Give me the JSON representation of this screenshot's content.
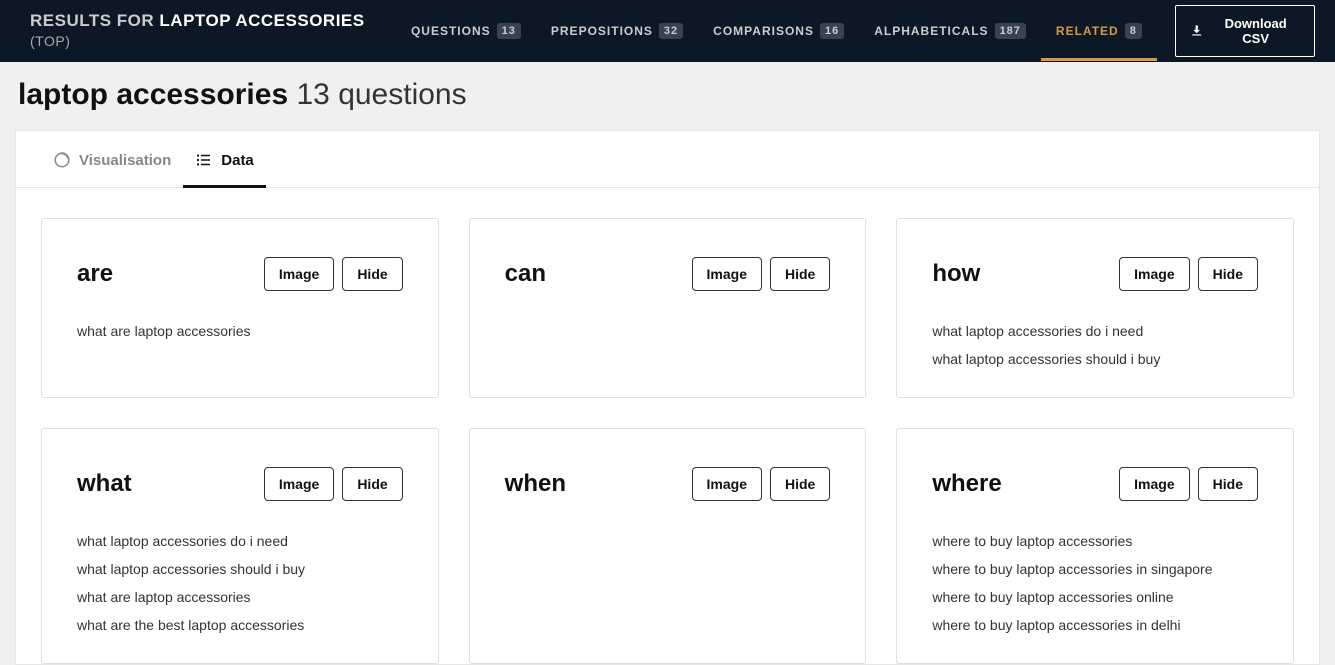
{
  "header": {
    "results_for_prefix": "RESULTS FOR",
    "keyword": "LAPTOP ACCESSORIES",
    "suffix": "(TOP)"
  },
  "nav": [
    {
      "label": "QUESTIONS",
      "count": "13",
      "active": false
    },
    {
      "label": "PREPOSITIONS",
      "count": "32",
      "active": false
    },
    {
      "label": "COMPARISONS",
      "count": "16",
      "active": false
    },
    {
      "label": "ALPHABETICALS",
      "count": "187",
      "active": false
    },
    {
      "label": "RELATED",
      "count": "8",
      "active": true
    }
  ],
  "download_label": "Download CSV",
  "page_title": {
    "keyword": "laptop accessories",
    "count": "13 questions"
  },
  "view_tabs": {
    "visualisation": "Visualisation",
    "data": "Data"
  },
  "buttons": {
    "image": "Image",
    "hide": "Hide"
  },
  "cards": [
    {
      "title": "are",
      "items": [
        "what are laptop accessories"
      ]
    },
    {
      "title": "can",
      "items": []
    },
    {
      "title": "how",
      "items": [
        "what laptop accessories do i need",
        "what laptop accessories should i buy"
      ]
    },
    {
      "title": "what",
      "items": [
        "what laptop accessories do i need",
        "what laptop accessories should i buy",
        "what are laptop accessories",
        "what are the best laptop accessories"
      ]
    },
    {
      "title": "when",
      "items": []
    },
    {
      "title": "where",
      "items": [
        "where to buy laptop accessories",
        "where to buy laptop accessories in singapore",
        "where to buy laptop accessories online",
        "where to buy laptop accessories in delhi"
      ]
    }
  ]
}
